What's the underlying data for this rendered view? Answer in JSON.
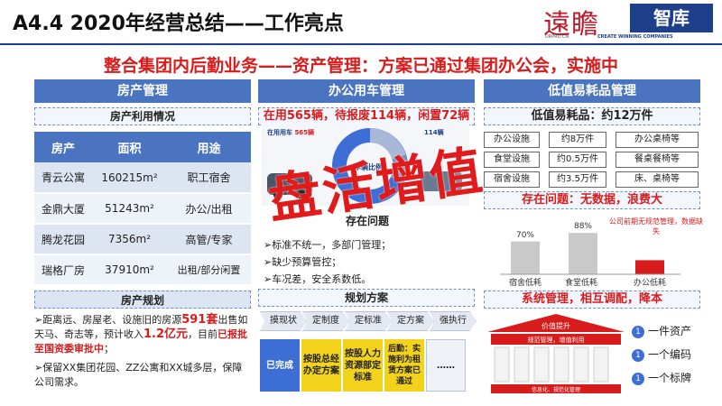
{
  "header": {
    "title": "A4.4  2020年经营总结——工作亮点",
    "logo_cn": "遠瞻",
    "logo_box": "智库",
    "logo_url": "URPRO.CN",
    "logo_sub": "CREATE WINNING COMPANIES"
  },
  "headline": "整合集团内后勤业务——资产管理：方案已通过集团办公会，实施中",
  "left": {
    "header": "房产管理",
    "usage_title": "房产利用情况",
    "table_headers": [
      "房产",
      "面积",
      "用途"
    ],
    "rows": [
      {
        "name": "青云公寓",
        "area": "160215m²",
        "use": "职工宿舍"
      },
      {
        "name": "金鼎大厦",
        "area": "51243m²",
        "use": "办公/出租"
      },
      {
        "name": "腾龙花园",
        "area": "7356m²",
        "use": "高管/专家"
      },
      {
        "name": "瑞格厂房",
        "area": "37910m²",
        "use": "出租/部分闲置"
      }
    ],
    "plan_title": "房产规划",
    "plan1_a": "距离远、房屋老、设施旧的房源",
    "plan1_b": "591套",
    "plan1_c": "出售如天马、奇志等，预计收入",
    "plan1_d": "1.2亿元",
    "plan1_e": "，目前",
    "plan1_f": "已报批至国资委审批中",
    "plan1_g": "；",
    "plan2": "保留XX集团花园、ZZ公寓和XX城多层，保障公司需求。"
  },
  "middle": {
    "header": "办公用车管理",
    "status": "在用565辆，待报废114辆，闲置72辆",
    "car_label_left": "在用用车",
    "car_label_left_val": "565辆",
    "car_label_right": "114辆",
    "donut_label": "车辆比例",
    "stamp": "盘活增值",
    "problem_title": "存在问题",
    "problems": [
      "标准不统一，多部门管理；",
      "缺少预算管控；",
      "车况差，安全系数低。"
    ],
    "plan_title": "规划方案",
    "steps": [
      "摸现状",
      "定制度",
      "定标准",
      "定方案",
      "强执行"
    ],
    "plan_boxes": [
      "已完成",
      "按股总经办定方案",
      "按股人力资源部定标准",
      "后勤：实施利为租赁方案已通过",
      "……"
    ]
  },
  "right": {
    "header": "低值易耗品管理",
    "value_title": "低值易耗品：约12万件",
    "asset_rows": [
      {
        "type": "办公设施",
        "qty": "约8万件",
        "items": "办公桌椅等"
      },
      {
        "type": "食堂设施",
        "qty": "约0.5万件",
        "items": "餐桌餐椅等"
      },
      {
        "type": "宿舍设施",
        "qty": "约3.5万件",
        "items": "床、桌椅等"
      }
    ],
    "problem_title": "存在问题：无数据，浪费大",
    "chart_note": "公司前期无规范管理，数据缺失",
    "summary": "系统管理，相互调配，降本",
    "value_label": "价值提升",
    "mgmt_top": "规范管理，增值利用",
    "mgmt_bottom": "信息化、规范化管理",
    "legend": [
      "一件资产",
      "一个编码",
      "一个标牌"
    ],
    "legend_num": "1"
  },
  "chart_data": {
    "type": "bar",
    "categories": [
      "宿舍低耗",
      "食堂低耗",
      "办公低耗"
    ],
    "values": [
      70,
      88,
      30
    ],
    "value_labels": [
      "70%",
      "88%",
      ""
    ],
    "ylim": [
      0,
      100
    ],
    "colors": [
      "#c9c9c9",
      "#c9c9c9",
      "#d81c1c"
    ]
  },
  "colors": {
    "accent_blue": "#4a74bf",
    "dark_blue": "#1e3f8a",
    "red": "#d81c1c"
  }
}
